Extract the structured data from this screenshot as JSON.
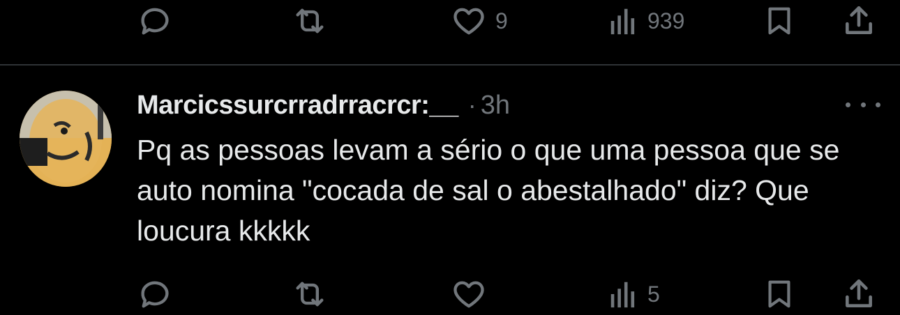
{
  "top_actions": {
    "reply_icon": "reply-icon",
    "retweet_icon": "retweet-icon",
    "like_count": "9",
    "views_count": "939",
    "bookmark_icon": "bookmark-icon",
    "share_icon": "share-icon"
  },
  "tweet": {
    "display_name": "Marcicssurcrradrracrcr:__",
    "separator": "·",
    "time": "3h",
    "text": "Pq as pessoas levam a sério o que uma pessoa que se auto nomina \"cocada de sal o abestalhado\" diz? Que loucura kkkkk",
    "more_icon": "more-horizontal-icon",
    "avatar_icon": "avatar"
  },
  "bottom_actions": {
    "views_count": "5"
  },
  "colors": {
    "background": "#000000",
    "text_primary": "#e7e9ea",
    "text_secondary": "#71767b",
    "divider": "#2f3336"
  }
}
